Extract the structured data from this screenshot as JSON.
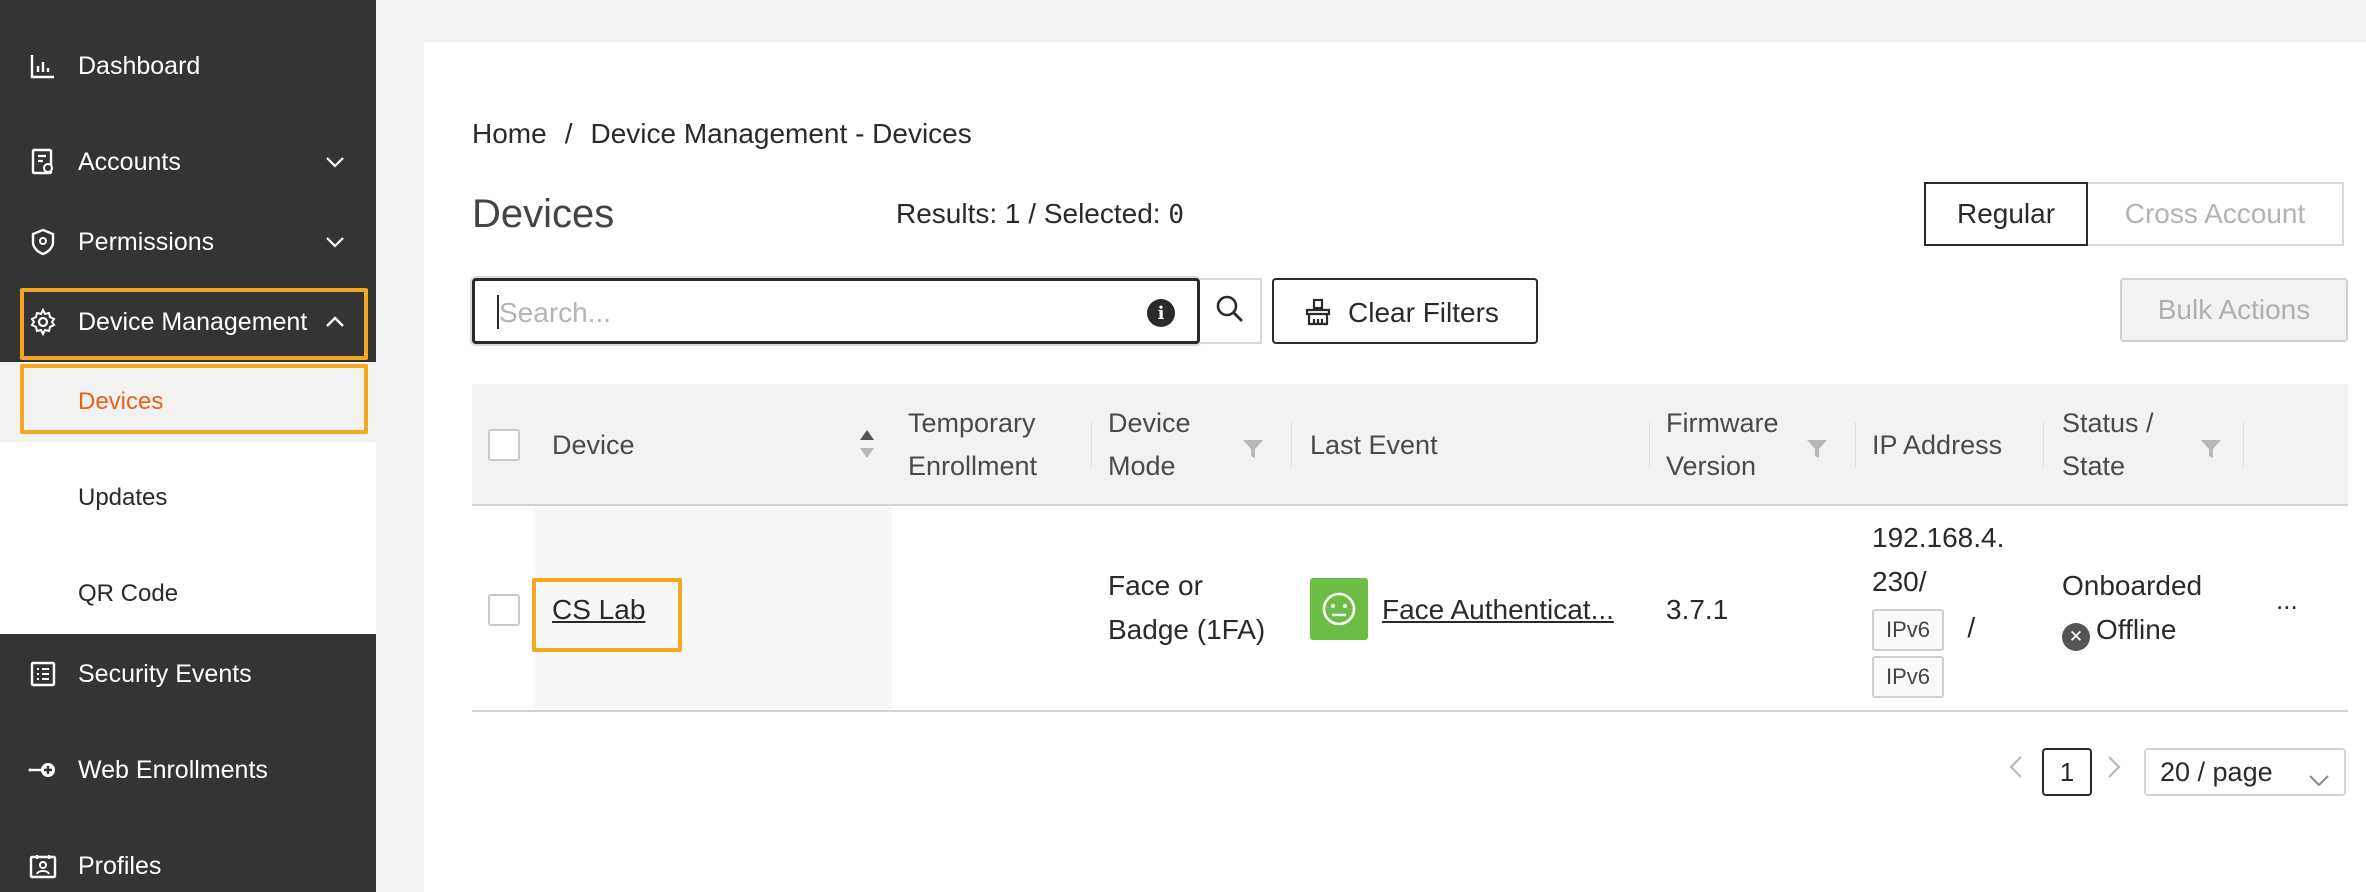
{
  "sidebar": {
    "items": [
      {
        "label": "Dashboard",
        "icon": "bar-chart-icon"
      },
      {
        "label": "Accounts",
        "icon": "account-book-icon",
        "expandable": true
      },
      {
        "label": "Permissions",
        "icon": "shield-icon",
        "expandable": true
      },
      {
        "label": "Device Management",
        "icon": "gear-icon",
        "expanded": true
      },
      {
        "label": "Security Events",
        "icon": "list-icon"
      },
      {
        "label": "Web Enrollments",
        "icon": "login-key-icon"
      },
      {
        "label": "Profiles",
        "icon": "id-card-icon"
      }
    ],
    "subitems": [
      {
        "label": "Devices",
        "active": true
      },
      {
        "label": "Updates"
      },
      {
        "label": "QR Code"
      }
    ]
  },
  "breadcrumb": {
    "home": "Home",
    "separator": "/",
    "current": "Device Management - Devices"
  },
  "page": {
    "title": "Devices",
    "results_label": "Results: 1 / Selected: ",
    "selected_count": "0"
  },
  "view_toggle": {
    "regular": "Regular",
    "cross_account": "Cross Account",
    "selected": "regular"
  },
  "search": {
    "placeholder": "Search..."
  },
  "buttons": {
    "clear_filters": "Clear Filters",
    "bulk_actions": "Bulk Actions"
  },
  "table": {
    "columns": {
      "device": "Device",
      "temp_line1": "Temporary",
      "temp_line2": "Enrollment",
      "mode_line1": "Device",
      "mode_line2": "Mode",
      "last_event": "Last Event",
      "fw_line1": "Firmware",
      "fw_line2": "Version",
      "ip": "IP Address",
      "status_line1": "Status /",
      "status_line2": "State"
    },
    "rows": [
      {
        "device": "CS Lab",
        "mode_line1": "Face or",
        "mode_line2": "Badge (1FA)",
        "last_event": "Face Authenticat...",
        "firmware": "3.7.1",
        "ip_line1": "192.168.4.",
        "ip_line2": "230/",
        "ipv6_tag_1": "IPv6",
        "ip_sep": "/",
        "ipv6_tag_2": "IPv6",
        "status": "Onboarded",
        "state": "Offline",
        "actions": "..."
      }
    ]
  },
  "pagination": {
    "prev": "<",
    "current": "1",
    "next": ">",
    "page_size": "20 / page"
  },
  "colors": {
    "sidebar_bg": "#343434",
    "active_accent": "#e8611a",
    "highlight": "#f5a623",
    "event_green": "#6cbd45"
  }
}
